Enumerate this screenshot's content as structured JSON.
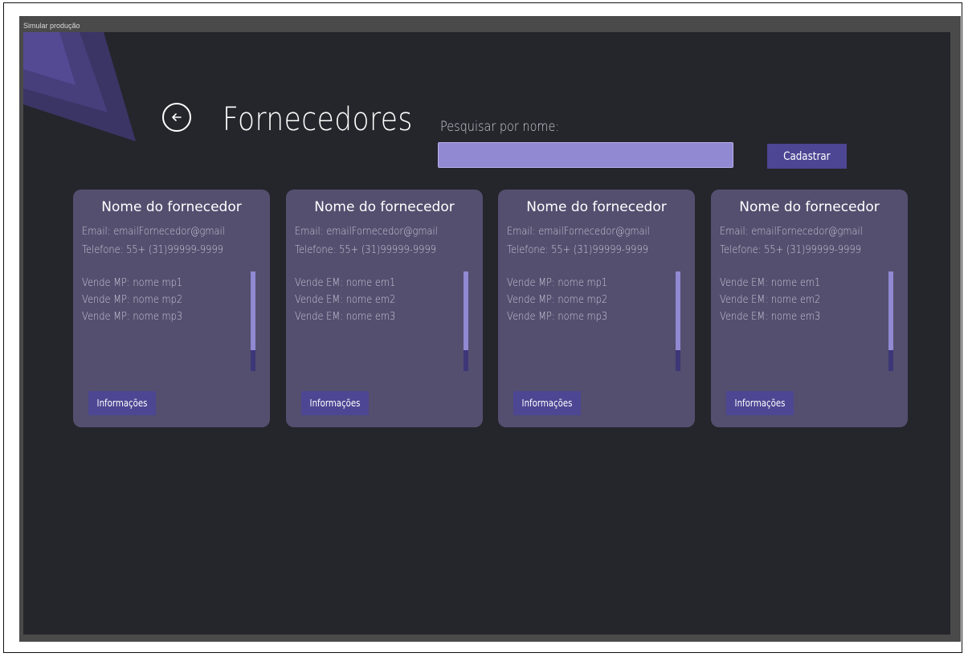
{
  "app": {
    "title": "Simular produção"
  },
  "header": {
    "title": "Fornecedores",
    "search_label": "Pesquisar por nome:",
    "search_value": "",
    "register_label": "Cadastrar"
  },
  "colors": {
    "accent": "#4c4693",
    "input_fill": "#9189d2",
    "card_bg": "#544f6f",
    "canvas_bg": "#25252c"
  },
  "cards": [
    {
      "name": "Nome do fornecedor",
      "email": "Email: emailFornecedor@gmail",
      "phone": "Telefone: 55+ (31)99999-9999",
      "items": [
        "Vende MP: nome mp1",
        "Vende MP: nome mp2",
        "Vende MP: nome mp3"
      ],
      "button": "Informações"
    },
    {
      "name": "Nome do fornecedor",
      "email": "Email: emailFornecedor@gmail",
      "phone": "Telefone: 55+ (31)99999-9999",
      "items": [
        "Vende EM: nome em1",
        "Vende EM: nome em2",
        "Vende EM: nome em3"
      ],
      "button": "Informações"
    },
    {
      "name": "Nome do fornecedor",
      "email": "Email: emailFornecedor@gmail",
      "phone": "Telefone: 55+ (31)99999-9999",
      "items": [
        "Vende MP: nome mp1",
        "Vende MP: nome mp2",
        "Vende MP: nome mp3"
      ],
      "button": "Informações"
    },
    {
      "name": "Nome do fornecedor",
      "email": "Email: emailFornecedor@gmail",
      "phone": "Telefone: 55+ (31)99999-9999",
      "items": [
        "Vende EM: nome em1",
        "Vende EM: nome em2",
        "Vende EM: nome em3"
      ],
      "button": "Informações"
    }
  ]
}
